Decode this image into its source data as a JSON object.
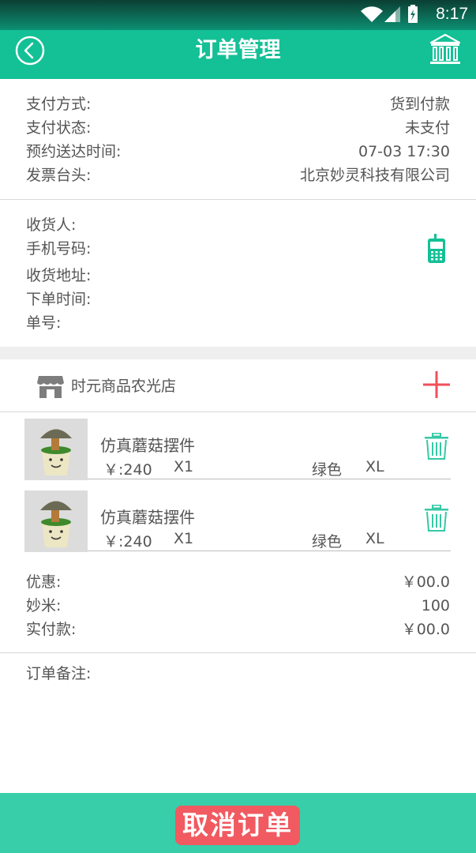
{
  "status_bar": {
    "time": "8:17"
  },
  "header": {
    "title": "订单管理"
  },
  "order_info": [
    {
      "label": "支付方式:",
      "value": "货到付款"
    },
    {
      "label": "支付状态:",
      "value": "未支付"
    },
    {
      "label": "预约送达时间:",
      "value": "07-03 17:30"
    },
    {
      "label": "发票台头:",
      "value": "北京妙灵科技有限公司"
    }
  ],
  "consignee": {
    "receiver_label": "收货人:",
    "phone_label": "手机号码:",
    "address_label": "收货地址:",
    "order_time_label": "下单时间:",
    "order_no_label": "单号:"
  },
  "store": {
    "name": "时元商品农光店"
  },
  "items": [
    {
      "name": "仿真蘑菇摆件",
      "price": "￥:240",
      "qty": "X1",
      "color": "绿色",
      "size": "XL"
    },
    {
      "name": "仿真蘑菇摆件",
      "price": "￥:240",
      "qty": "X1",
      "color": "绿色",
      "size": "XL"
    }
  ],
  "totals": [
    {
      "label": "优惠:",
      "value": "￥00.0"
    },
    {
      "label": "妙米:",
      "value": "100"
    },
    {
      "label": "实付款:",
      "value": "￥00.0"
    }
  ],
  "remark": {
    "label": "订单备注:"
  },
  "footer": {
    "cancel_label": "取消订单"
  },
  "colors": {
    "header": "#14c096",
    "footer": "#38cea9",
    "cancel": "#f05a60",
    "add_icon": "#f0505a",
    "trash_icon": "#35c9a5"
  }
}
